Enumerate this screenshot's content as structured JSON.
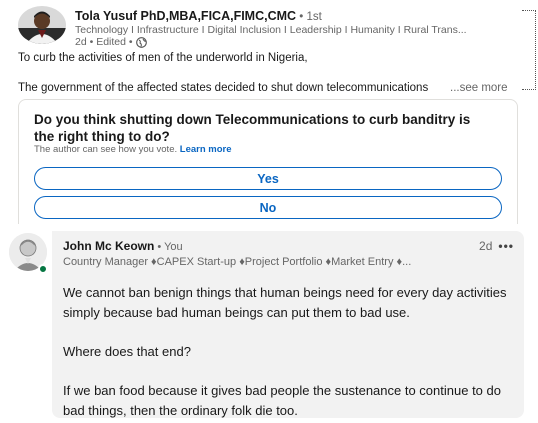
{
  "post": {
    "author": {
      "name": "Tola Yusuf PhD,MBA,FICA,FIMC,CMC",
      "degree": " • 1st",
      "headline": "Technology I Infrastructure I Digital Inclusion I Leadership I Humanity I Rural Trans...",
      "time": "2d • Edited •",
      "visibility_icon": "globe-icon"
    },
    "text_line1": "To curb the activities of men of the underworld in Nigeria,",
    "text_line2": "The government of the affected states decided to shut down telecommunications",
    "see_more_label": "...see more",
    "poll": {
      "question": "Do you think shutting down Telecommunications to curb banditry is the right thing to do?",
      "note": "The author can see how you vote.",
      "learn_more_label": "Learn more",
      "options": [
        "Yes",
        "No"
      ]
    }
  },
  "comment": {
    "author": {
      "name": "John Mc Keown",
      "you_label": " • You",
      "headline": "Country Manager ♦CAPEX Start-up ♦Project Portfolio ♦Market Entry ♦...",
      "online": true
    },
    "time": "2d",
    "more_icon": "more-icon",
    "text": "We cannot ban benign things that human beings need for every day activities simply because bad human beings can put them to bad use.\n\nWhere does that end?\n\nIf we ban food because it gives bad people the sustenance to continue to do bad things, then the ordinary folk die too."
  },
  "colors": {
    "brand_blue": "#0a66c2",
    "online_green": "#057642",
    "bubble_bg": "#f2f2f2",
    "secondary_text": "#666666"
  }
}
